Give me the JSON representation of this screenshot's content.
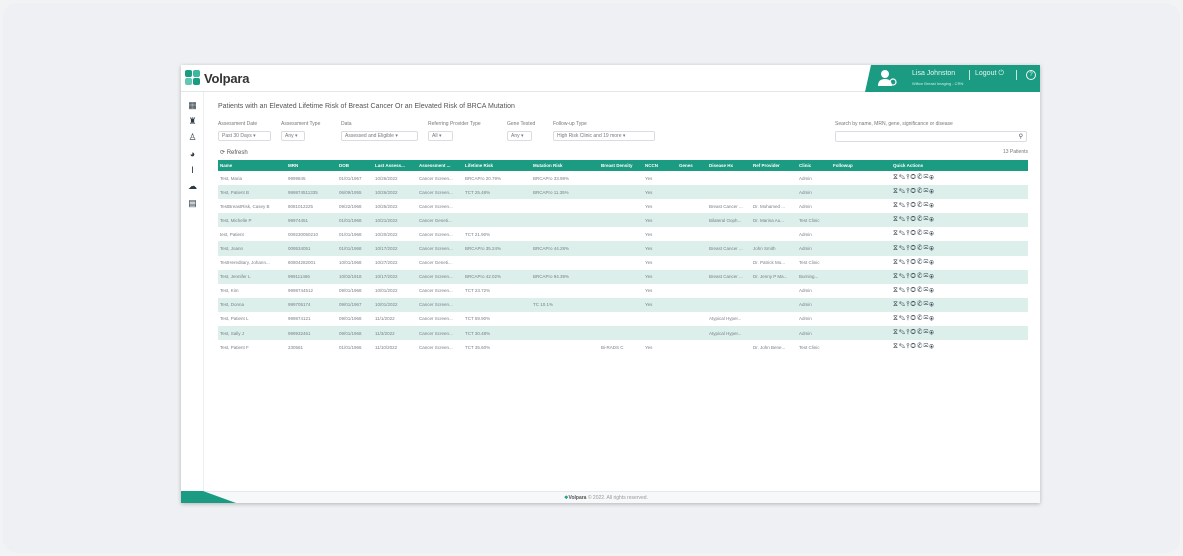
{
  "brand": {
    "name": "Volpara",
    "accent": "#1a9b82",
    "row_alt": "#dcefeb"
  },
  "user": {
    "name": "Lisa Johnston",
    "org": "Wilton Breast Imaging - CRN",
    "logout_label": "Logout",
    "help_icon": "?"
  },
  "sidebar": {
    "icons": [
      "patients-icon",
      "patient-list-icon",
      "person-icon",
      "pie-chart-icon",
      "info-icon",
      "chat-icon",
      "table-icon"
    ]
  },
  "page": {
    "title": "Patients with an Elevated Lifetime Risk of Breast Cancer Or an Elevated Risk of BRCA Mutation"
  },
  "filters": [
    {
      "label": "Assessment Date",
      "value": "Past 30 Days"
    },
    {
      "label": "Assessment Type",
      "value": "Any"
    },
    {
      "label": "Data",
      "value": "Assessed and Eligible"
    },
    {
      "label": "Referring Provider Type",
      "value": "All"
    },
    {
      "label": "Gene Tested",
      "value": "Any"
    },
    {
      "label": "Follow-up Type",
      "value": "High Risk Clinic and 19 more"
    }
  ],
  "search": {
    "label": "Search by name, MRN, gene, significance or disease",
    "placeholder": ""
  },
  "toolbar": {
    "refresh_label": "Refresh",
    "count_label": "13 Patients"
  },
  "table": {
    "columns": [
      "Name",
      "MRN",
      "DOB",
      "Last Assess...",
      "Assessment ...",
      "Lifetime Risk",
      "Mutation Risk",
      "Breast Density",
      "NCCN",
      "Genes",
      "Disease Hx",
      "Ref Provider",
      "Clinic",
      "Followup",
      "Quick Actions"
    ],
    "rows": [
      [
        "Test, Maria",
        "9999845",
        "01/01/1967",
        "10/26/2022",
        "Cancer Screen...",
        "BRCAPro 20.79%",
        "BRCAPro 33.98%",
        "",
        "Yes",
        "",
        "",
        "",
        "Admin",
        "",
        ""
      ],
      [
        "Test, Patient B",
        "999874511335",
        "06/09/1955",
        "10/26/2022",
        "Cancer Screen...",
        "TCT 25.48%",
        "BRCAPro 11.35%",
        "",
        "Yes",
        "",
        "",
        "",
        "Admin",
        "",
        ""
      ],
      [
        "TestBreastRisk, Casey B",
        "8081012225",
        "09/22/1968",
        "10/25/2022",
        "Cancer Screen...",
        "",
        "",
        "",
        "Yes",
        "",
        "Breast Cancer ...",
        "Dr. Mohamed ...",
        "Admin",
        "",
        ""
      ],
      [
        "Test, Michelle P",
        "99974451",
        "01/01/1968",
        "10/21/2022",
        "Cancer Geneti...",
        "",
        "",
        "",
        "Yes",
        "",
        "Bilateral Ooph...",
        "Dr. Marina Au...",
        "Test Clinic",
        "",
        ""
      ],
      [
        "test, Patient",
        "009230050210",
        "01/01/1968",
        "10/20/2022",
        "Cancer Screen...",
        "TCT 21.90%",
        "",
        "",
        "Yes",
        "",
        "",
        "",
        "Admin",
        "",
        ""
      ],
      [
        "Test, Joann",
        "009534051",
        "01/01/1968",
        "10/17/2022",
        "Cancer Screen...",
        "BRCAPro 35.24%",
        "BRCAPro 44.28%",
        "",
        "Yes",
        "",
        "Breast Cancer ...",
        "John Smith",
        "Admin",
        "",
        ""
      ],
      [
        "TestHereditary, Johann...",
        "80804282001",
        "10/01/1968",
        "10/27/2022",
        "Cancer Geneti...",
        "",
        "",
        "",
        "Yes",
        "",
        "",
        "Dr. Patrick Mo...",
        "Test Clinic",
        "",
        ""
      ],
      [
        "Test, Jennifer L",
        "999111466",
        "10/02/1918",
        "10/17/2022",
        "Cancer Screen...",
        "BRCAPro 42.02%",
        "BRCAPro 94.39%",
        "",
        "Yes",
        "",
        "Breast Cancer ...",
        "Dr. Jenny P Ma...",
        "Burning...",
        "",
        ""
      ],
      [
        "Test, Kim",
        "9998744512",
        "09/01/1968",
        "10/01/2022",
        "Cancer Screen...",
        "TCT 23.72%",
        "",
        "",
        "Yes",
        "",
        "",
        "",
        "Admin",
        "",
        ""
      ],
      [
        "Test, Donna",
        "999705174",
        "09/01/1967",
        "10/01/2022",
        "Cancer Screen...",
        "",
        "TC 10.1%",
        "",
        "Yes",
        "",
        "",
        "",
        "Admin",
        "",
        ""
      ],
      [
        "Test, Patient L",
        "999874121",
        "09/01/1968",
        "11/1/2022",
        "Cancer Screen...",
        "TCT 59.90%",
        "",
        "",
        "",
        "",
        "Atypical Hyper...",
        "",
        "Admin",
        "",
        ""
      ],
      [
        "Test, Sally J",
        "999932461",
        "09/01/1968",
        "11/3/2022",
        "Cancer Screen...",
        "TCT 30.48%",
        "",
        "",
        "",
        "",
        "Atypical Hyper...",
        "",
        "Admin",
        "",
        ""
      ],
      [
        "Test, Patient F",
        "230561",
        "01/01/1966",
        "11/10/2022",
        "Cancer Screen...",
        "TCT 35.60%",
        "",
        "Bi-RADS C",
        "Yes",
        "",
        "",
        "Dr. John Bene...",
        "Test Clinic",
        "",
        ""
      ]
    ],
    "quick_actions": [
      "dna-icon",
      "edit-icon",
      "pedigree-icon",
      "target-icon",
      "phone-icon",
      "letter-icon",
      "history-icon"
    ],
    "quick_action_glyphs": [
      "⧖",
      "✎",
      "⫯",
      "◎",
      "✆",
      "✉",
      "⦿"
    ]
  },
  "footer": {
    "logo": "Volpara",
    "copyright": "© 2022. All rights reserved."
  }
}
